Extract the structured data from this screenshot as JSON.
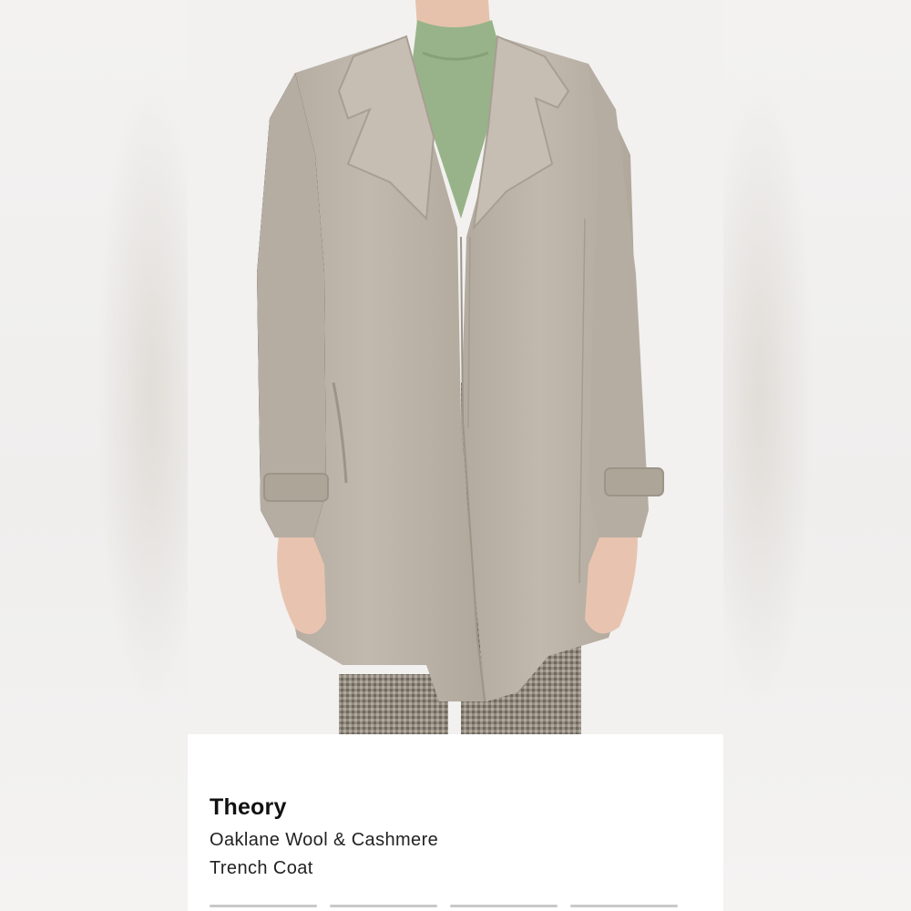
{
  "product": {
    "brand": "Theory",
    "name_line_1": "Oaklane Wool & Cashmere",
    "name_line_2": "Trench Coat",
    "image_icon": "product-photo"
  },
  "colors": {
    "coat": "#bcb3a8",
    "sweater": "#96b287",
    "trousers": "#8a8378",
    "skin": "#e9c6b3",
    "background": "#f2f1f0"
  }
}
